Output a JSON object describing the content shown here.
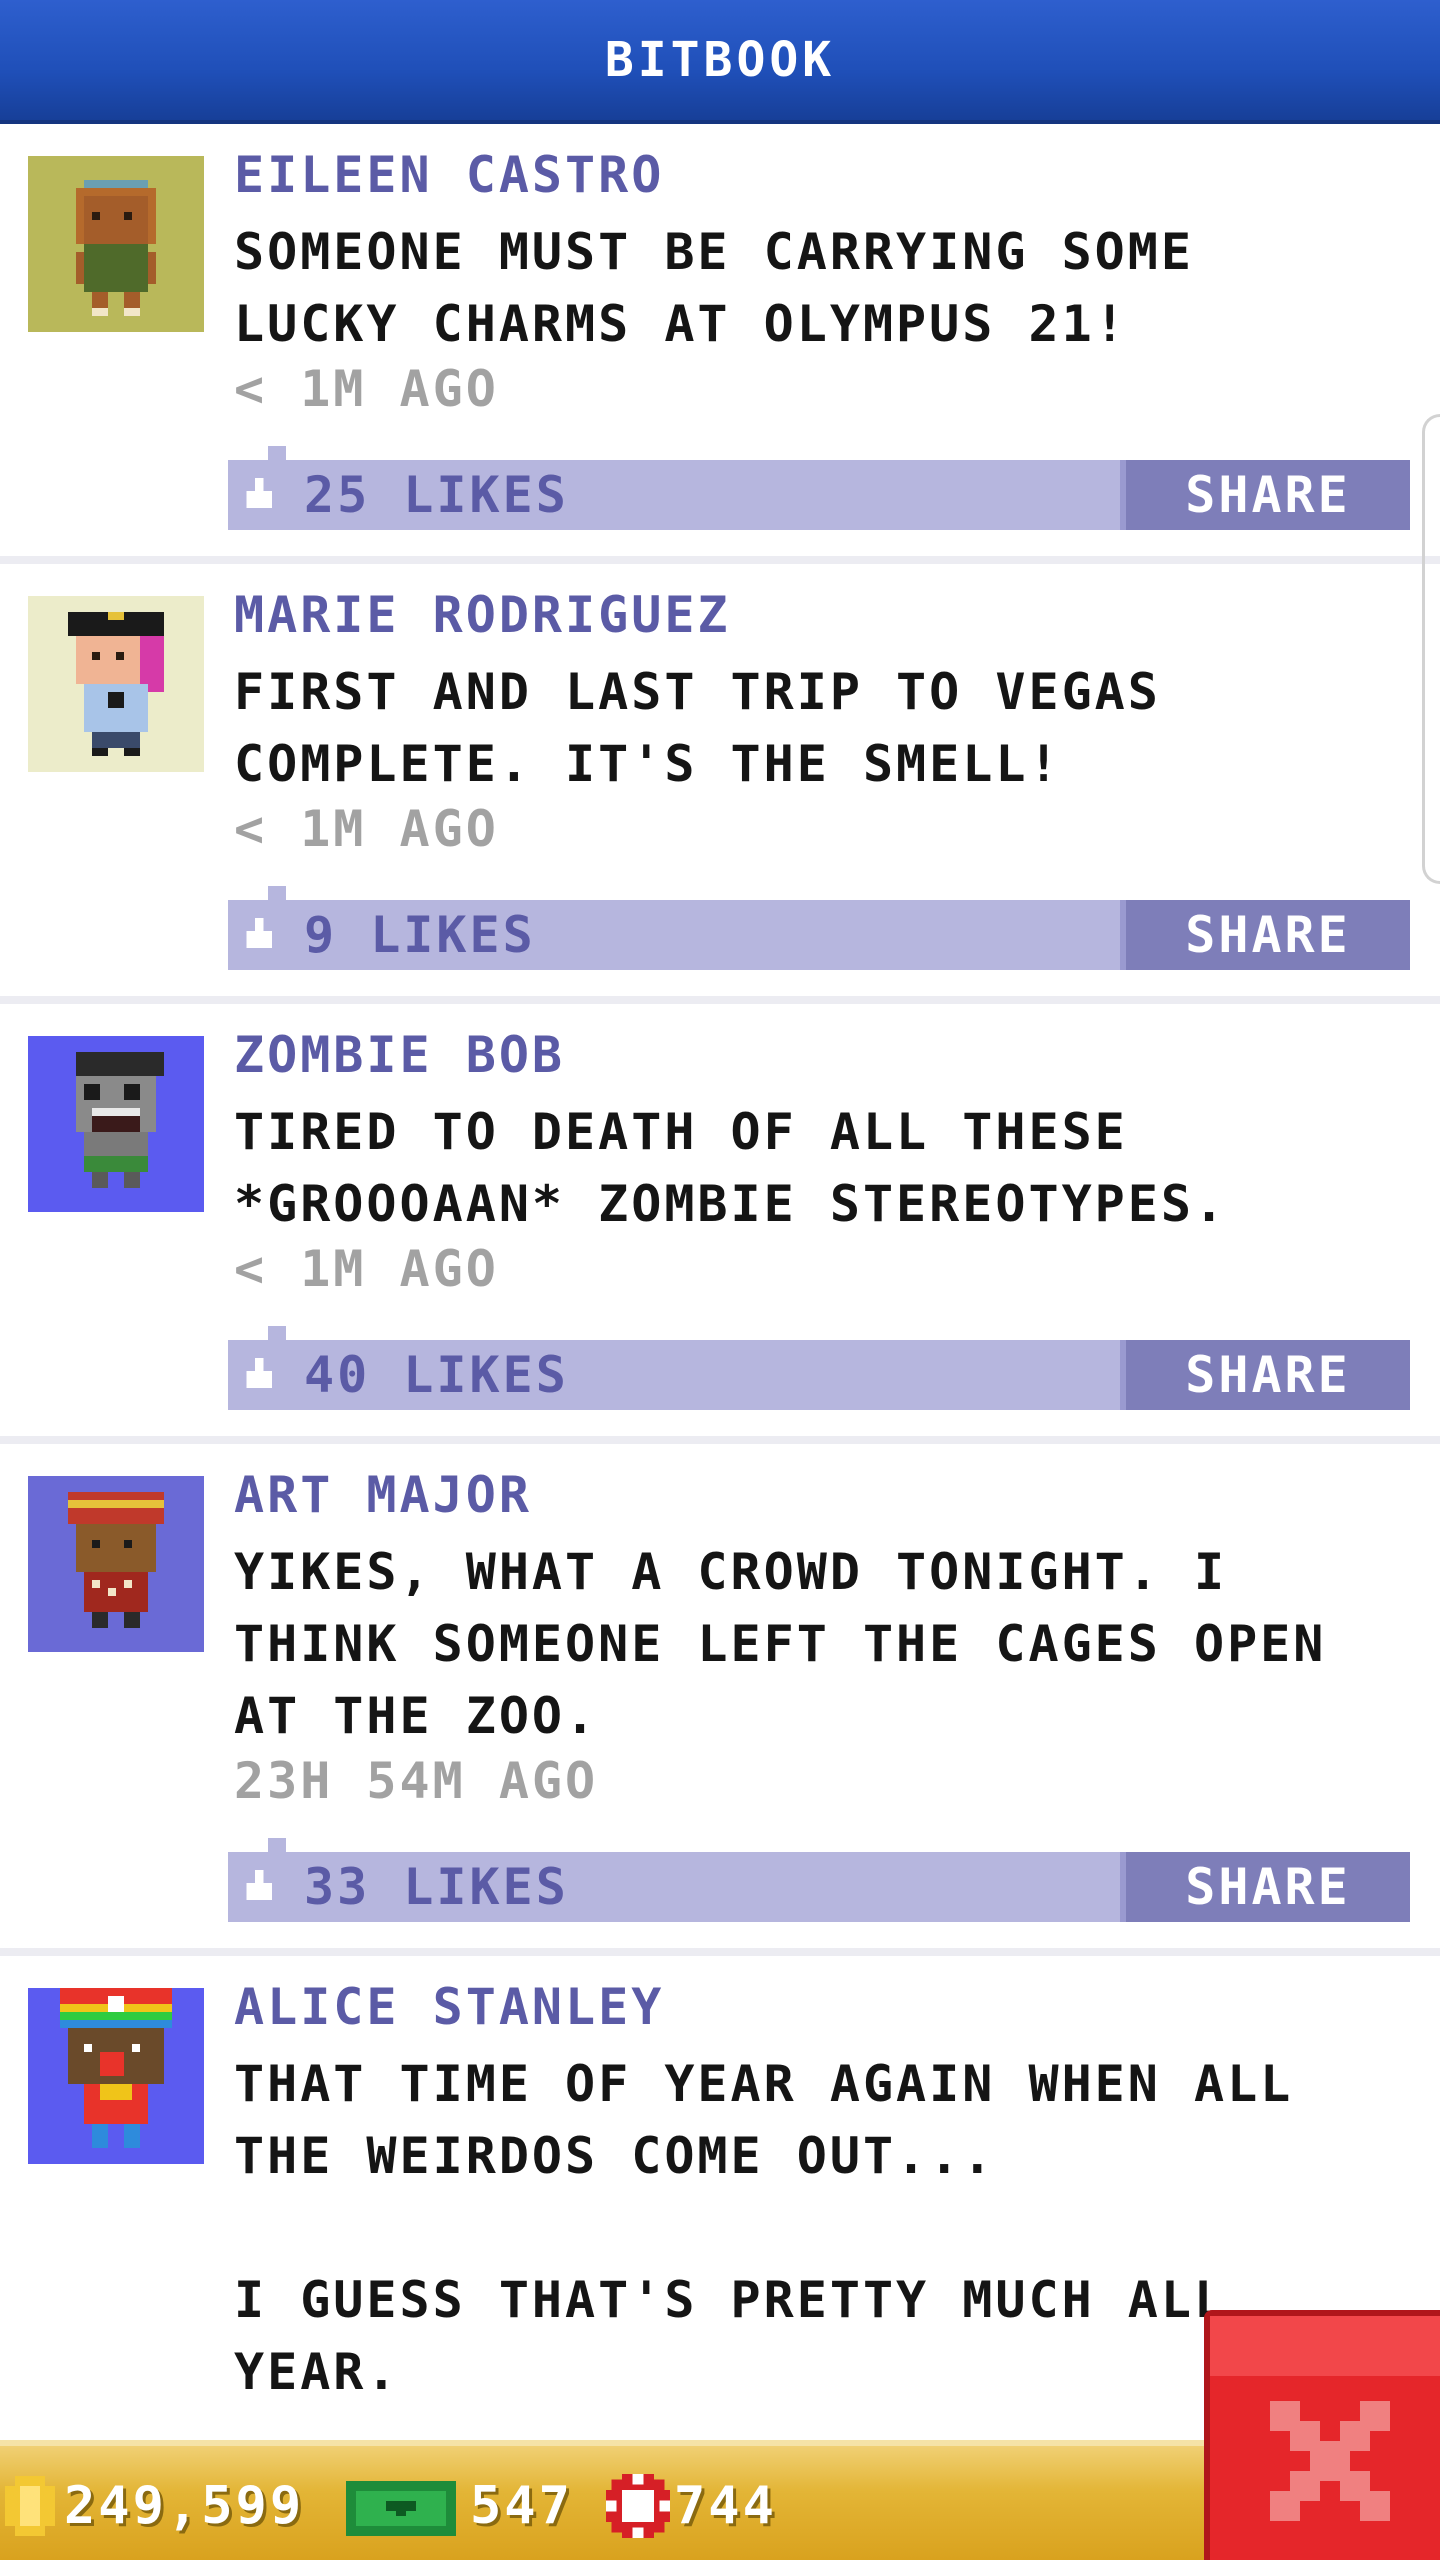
{
  "app": {
    "title": "BITBOOK"
  },
  "posts": [
    {
      "name": "EILEEN CASTRO",
      "message": "SOMEONE MUST BE CARRYING SOME\nLUCKY CHARMS AT OLYMPUS 21!",
      "time": "< 1M AGO",
      "likes": "25 LIKES",
      "share": "SHARE",
      "avatar_bg": "#b9b85a"
    },
    {
      "name": "MARIE RODRIGUEZ",
      "message": "FIRST AND LAST TRIP TO VEGAS\nCOMPLETE. IT'S THE SMELL!",
      "time": "< 1M AGO",
      "likes": "9 LIKES",
      "share": "SHARE",
      "avatar_bg": "#ececca"
    },
    {
      "name": "ZOMBIE BOB",
      "message": "TIRED TO DEATH OF ALL THESE\n*GROOOAAN* ZOMBIE STEREOTYPES.",
      "time": "< 1M AGO",
      "likes": "40 LIKES",
      "share": "SHARE",
      "avatar_bg": "#5b5bf0"
    },
    {
      "name": "ART MAJOR",
      "message": "YIKES, WHAT A CROWD TONIGHT. I\nTHINK SOMEONE LEFT THE CAGES OPEN\nAT THE ZOO.",
      "time": "23H 54M AGO",
      "likes": "33 LIKES",
      "share": "SHARE",
      "avatar_bg": "#6a6ad6"
    },
    {
      "name": "ALICE STANLEY",
      "message": "THAT TIME OF YEAR AGAIN WHEN ALL\nTHE WEIRDOS COME OUT...\n\nI GUESS THAT'S PRETTY MUCH ALL\nYEAR.",
      "time": "",
      "likes": "",
      "share": "",
      "avatar_bg": "#5b5bf0"
    }
  ],
  "currency": {
    "coins": "249,599",
    "bux": "547",
    "chips": "744"
  },
  "close": {
    "icon": "close-icon"
  }
}
